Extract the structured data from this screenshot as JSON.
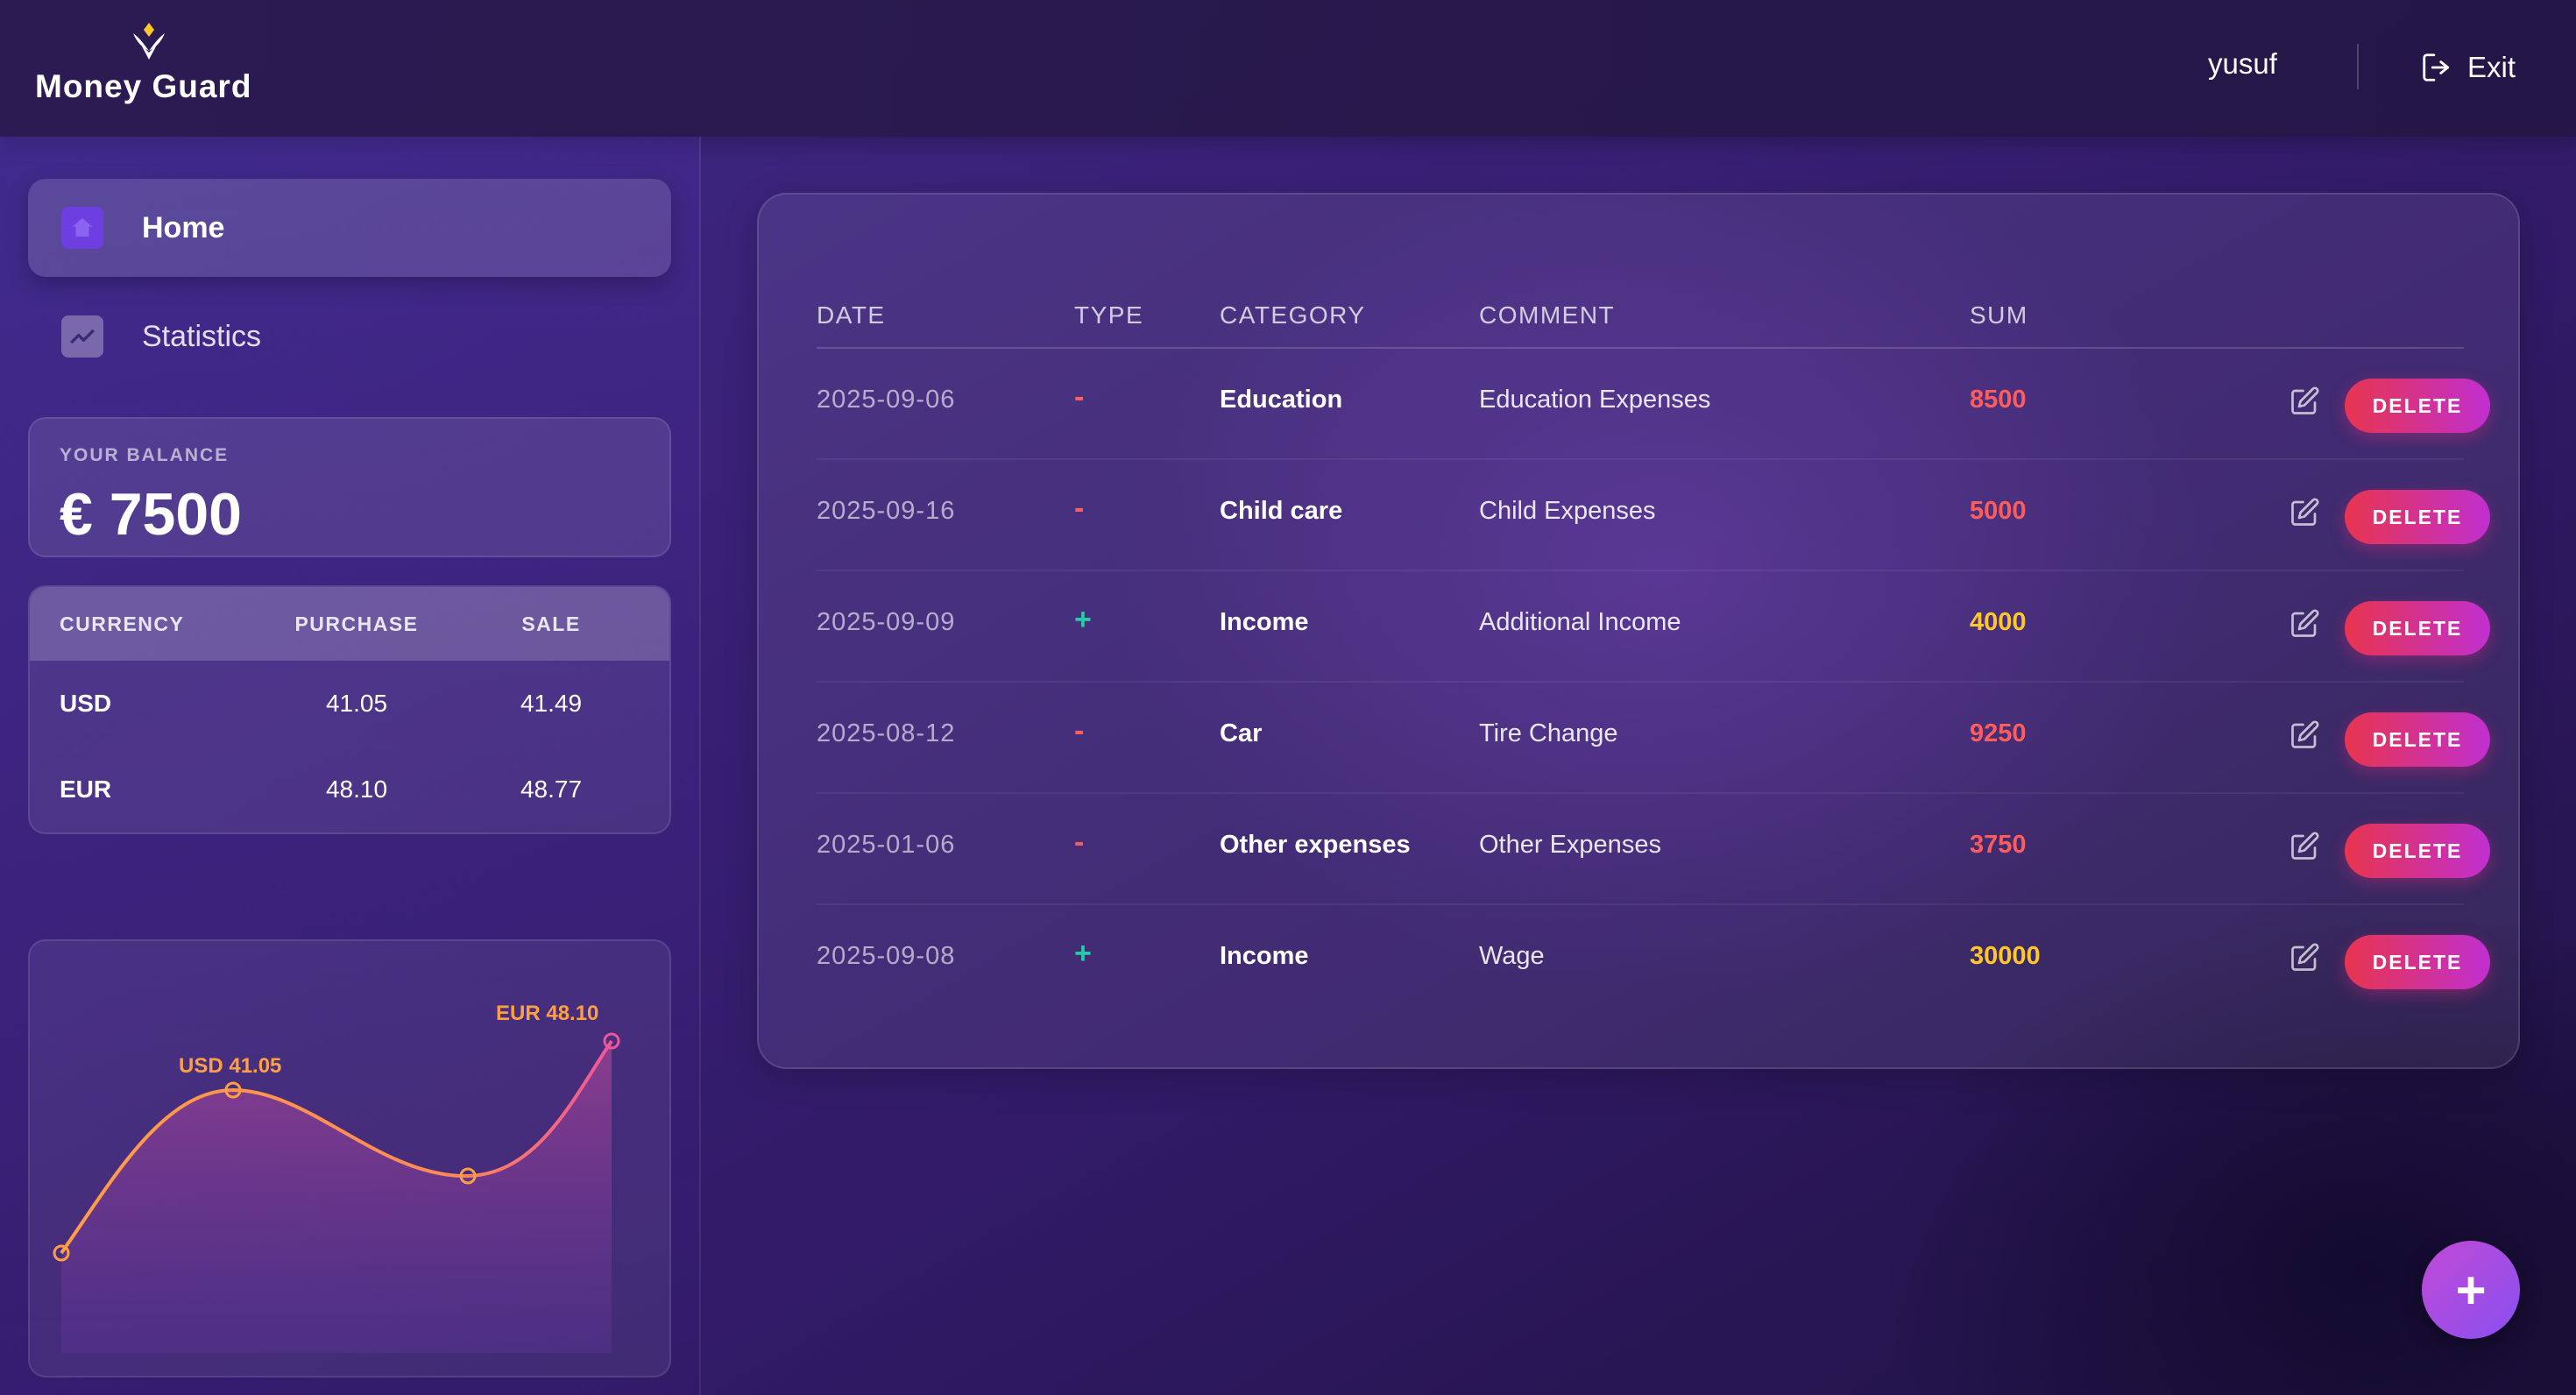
{
  "app": {
    "name": "Money Guard"
  },
  "header": {
    "user": "yusuf",
    "exit_label": "Exit"
  },
  "sidebar": {
    "items": [
      {
        "label": "Home",
        "icon": "home-icon",
        "active": true
      },
      {
        "label": "Statistics",
        "icon": "chart-line-icon",
        "active": false
      }
    ],
    "balance": {
      "title": "YOUR BALANCE",
      "value": "€ 7500"
    },
    "currency": {
      "headers": [
        "CURRENCY",
        "PURCHASE",
        "SALE"
      ],
      "rows": [
        {
          "currency": "USD",
          "purchase": "41.05",
          "sale": "41.49"
        },
        {
          "currency": "EUR",
          "purchase": "48.10",
          "sale": "48.77"
        }
      ]
    },
    "chart": {
      "usd_label": "USD 41.05",
      "eur_label": "EUR 48.10"
    }
  },
  "table": {
    "headers": {
      "date": "DATE",
      "type": "TYPE",
      "category": "CATEGORY",
      "comment": "COMMENT",
      "sum": "SUM"
    },
    "delete_label": "DELETE",
    "rows": [
      {
        "date": "2025-09-06",
        "type": "-",
        "category": "Education",
        "comment": "Education Expenses",
        "sum": "8500"
      },
      {
        "date": "2025-09-16",
        "type": "-",
        "category": "Child care",
        "comment": "Child Expenses",
        "sum": "5000"
      },
      {
        "date": "2025-09-09",
        "type": "+",
        "category": "Income",
        "comment": "Additional Income",
        "sum": "4000"
      },
      {
        "date": "2025-08-12",
        "type": "-",
        "category": "Car",
        "comment": "Tire Change",
        "sum": "9250"
      },
      {
        "date": "2025-01-06",
        "type": "-",
        "category": "Other expenses",
        "comment": "Other Expenses",
        "sum": "3750"
      },
      {
        "date": "2025-09-08",
        "type": "+",
        "category": "Income",
        "comment": "Wage",
        "sum": "30000"
      }
    ]
  },
  "colors": {
    "expense": "#ff5c5c",
    "income_sum": "#ffc727",
    "income_sign": "#24cca7",
    "chart_line": "#ff9f45",
    "accent": "#6d3fe0"
  },
  "fab": {
    "label": "+"
  }
}
